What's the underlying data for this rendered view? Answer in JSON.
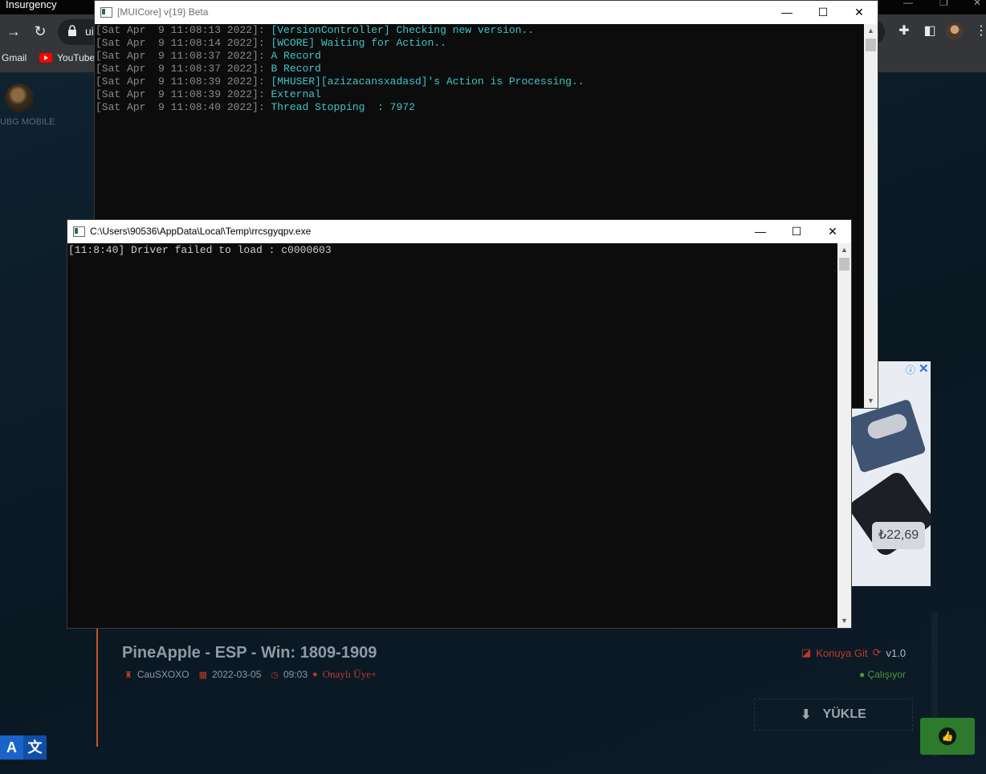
{
  "browser": {
    "tab_title": "Insurgency",
    "url_fragment": "ui",
    "bookmarks": [
      {
        "label": "Gmail"
      },
      {
        "label": "YouTube"
      }
    ]
  },
  "sidebar": {
    "game_label": "UBG MOBILE"
  },
  "ad": {
    "price": "₺22,69"
  },
  "post": {
    "title": "PineApple - ESP - Win: 1809-1909",
    "author": "CauSXOXO",
    "date": "2022-03-05",
    "time": "09:03",
    "role": "Onaylı Üye+",
    "topic_link": "Konuya Git",
    "version": "v1.0",
    "status": "Çalışıyor",
    "download_label": "YÜKLE"
  },
  "translate": {
    "left": "A",
    "right": "文"
  },
  "console_main": {
    "title": "[MUICore] v{19} Beta",
    "lines": [
      {
        "ts": "[Sat Apr  9 11:08:13 2022]: ",
        "msg": "[VersionController] Checking new version.."
      },
      {
        "ts": "[Sat Apr  9 11:08:14 2022]: ",
        "msg": "[WCORE] Waiting for Action.."
      },
      {
        "ts": "[Sat Apr  9 11:08:37 2022]: ",
        "msg": "A Record"
      },
      {
        "ts": "[Sat Apr  9 11:08:37 2022]: ",
        "msg": "B Record"
      },
      {
        "ts": "[Sat Apr  9 11:08:39 2022]: ",
        "msg": "[MHUSER][azizacansxadasd]'s Action is Processing.."
      },
      {
        "ts": "[Sat Apr  9 11:08:39 2022]: ",
        "msg": "External"
      },
      {
        "ts": "[Sat Apr  9 11:08:40 2022]: ",
        "msg": "Thread Stopping  : 7972"
      }
    ]
  },
  "console_temp": {
    "title": "C:\\Users\\90536\\AppData\\Local\\Temp\\rrcsgyqpv.exe",
    "lines": [
      "[11:8:40] Driver failed to load : c0000603"
    ]
  },
  "colors": {
    "console_bg": "#0c0c0c",
    "console_timestamp": "#8a8a8a",
    "console_message": "#3ec5c9",
    "accent_red": "#c0392b",
    "status_green": "#4e9a3a",
    "like_green": "#2d7a2d"
  }
}
